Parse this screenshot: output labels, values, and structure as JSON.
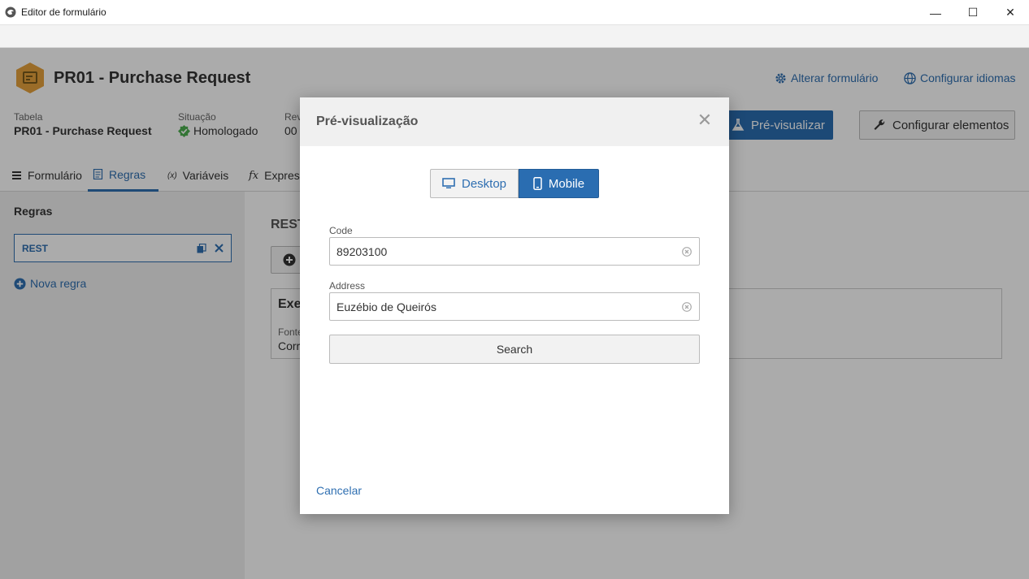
{
  "window": {
    "title": "Editor de formulário",
    "minimize": "—",
    "maximize": "☐",
    "close": "✕"
  },
  "header": {
    "form_title": "PR01 - Purchase Request",
    "link_change_form": "Alterar formulário",
    "link_languages": "Configurar idiomas",
    "meta": {
      "table_label": "Tabela",
      "table_value": "PR01 - Purchase Request",
      "status_label": "Situação",
      "status_value": "Homologado",
      "revision_label": "Rev",
      "revision_value": "00"
    },
    "preview_button": "Pré-visualizar",
    "config_button": "Configurar elementos"
  },
  "tabs": [
    {
      "label": "Formulário"
    },
    {
      "label": "Regras"
    },
    {
      "label": "Variáveis"
    },
    {
      "label": "Express"
    }
  ],
  "sidebar": {
    "heading": "Regras",
    "rule": "REST",
    "new_rule": "Nova regra"
  },
  "main": {
    "section_title": "REST",
    "exec_title": "Exe",
    "source_label": "Fonte",
    "source_value": "Corr"
  },
  "modal": {
    "title": "Pré-visualização",
    "close": "✕",
    "toggle": {
      "desktop": "Desktop",
      "mobile": "Mobile",
      "selected": "Mobile"
    },
    "fields": {
      "code_label": "Code",
      "code_value": "89203100",
      "address_label": "Address",
      "address_value": "Euzébio de Queirós"
    },
    "search_button": "Search",
    "cancel": "Cancelar"
  },
  "colors": {
    "accent": "#2a6db1",
    "link": "#2f6fb1",
    "status_ok": "#4caf50",
    "logo": "#e6a23c"
  }
}
